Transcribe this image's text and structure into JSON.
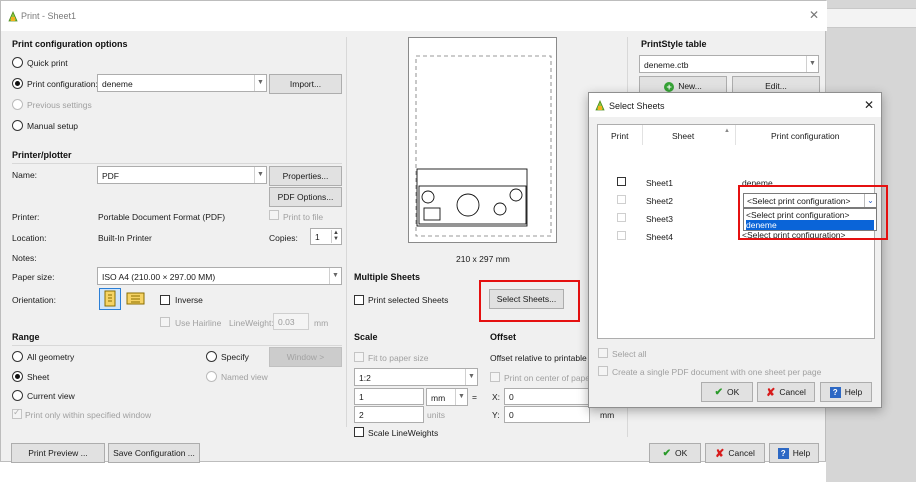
{
  "window": {
    "title": "Print - Sheet1"
  },
  "config": {
    "header": "Print configuration options",
    "quick_print": "Quick print",
    "print_config_label": "Print configuration:",
    "print_config_value": "deneme",
    "import_button": "Import...",
    "previous_settings": "Previous settings",
    "manual_setup": "Manual setup"
  },
  "printer": {
    "header": "Printer/plotter",
    "name_label": "Name:",
    "name_value": "PDF",
    "properties_button": "Properties...",
    "pdf_options_button": "PDF Options...",
    "printer_label": "Printer:",
    "printer_value": "Portable Document Format (PDF)",
    "print_to_file": "Print to file",
    "location_label": "Location:",
    "location_value": "Built-In Printer",
    "copies_label": "Copies:",
    "copies_value": "1",
    "notes_label": "Notes:",
    "paper_size_label": "Paper size:",
    "paper_size_value": "ISO A4 (210.00 × 297.00 MM)",
    "orientation_label": "Orientation:",
    "inverse": "Inverse",
    "use_hairline": "Use Hairline",
    "line_weight_label": "LineWeight:",
    "line_weight_value": "0.03",
    "line_weight_unit": "mm"
  },
  "range": {
    "header": "Range",
    "all_geometry": "All geometry",
    "specify": "Specify",
    "window_button": "Window >",
    "sheet": "Sheet",
    "named_view": "Named view",
    "current_view": "Current view",
    "print_within_window": "Print only within specified window"
  },
  "preview": {
    "size_text": "210 x 297 mm"
  },
  "multiple_sheets": {
    "header": "Multiple Sheets",
    "print_selected": "Print selected Sheets",
    "select_button": "Select Sheets..."
  },
  "scale": {
    "header": "Scale",
    "fit_to_paper": "Fit to paper size",
    "ratio_value": "1:2",
    "value1": "1",
    "unit1": "mm",
    "equals": "=",
    "value2": "2",
    "unit2": "units",
    "scale_lineweights": "Scale LineWeights"
  },
  "offset": {
    "header": "Offset",
    "relative_text": "Offset relative to printable a",
    "print_center": "Print on center of paper",
    "x_label": "X:",
    "x_value": "0",
    "y_label": "Y:",
    "y_value": "0",
    "unit": "mm"
  },
  "printstyle": {
    "header": "PrintStyle table",
    "value": "deneme.ctb",
    "new_button": "New...",
    "edit_button": "Edit..."
  },
  "footer": {
    "print_preview": "Print Preview ...",
    "save_configuration": "Save Configuration ...",
    "ok": "OK",
    "cancel": "Cancel",
    "help": "Help"
  },
  "select_sheets": {
    "title": "Select Sheets",
    "col_print": "Print",
    "col_sheet": "Sheet",
    "col_config": "Print configuration",
    "rows": [
      {
        "sheet": "Sheet1",
        "config": "deneme"
      },
      {
        "sheet": "Sheet2",
        "config": "<Select print configuration>"
      },
      {
        "sheet": "Sheet3",
        "config": ""
      },
      {
        "sheet": "Sheet4",
        "config": "<Select print configuration>"
      }
    ],
    "dropdown_options": [
      "<Select print configuration>",
      "deneme"
    ],
    "select_all": "Select all",
    "single_pdf": "Create a single PDF document with one sheet per page",
    "ok": "OK",
    "cancel": "Cancel",
    "help": "Help"
  },
  "colors": {
    "highlight": "#e51010",
    "selection": "#0a64d8"
  }
}
